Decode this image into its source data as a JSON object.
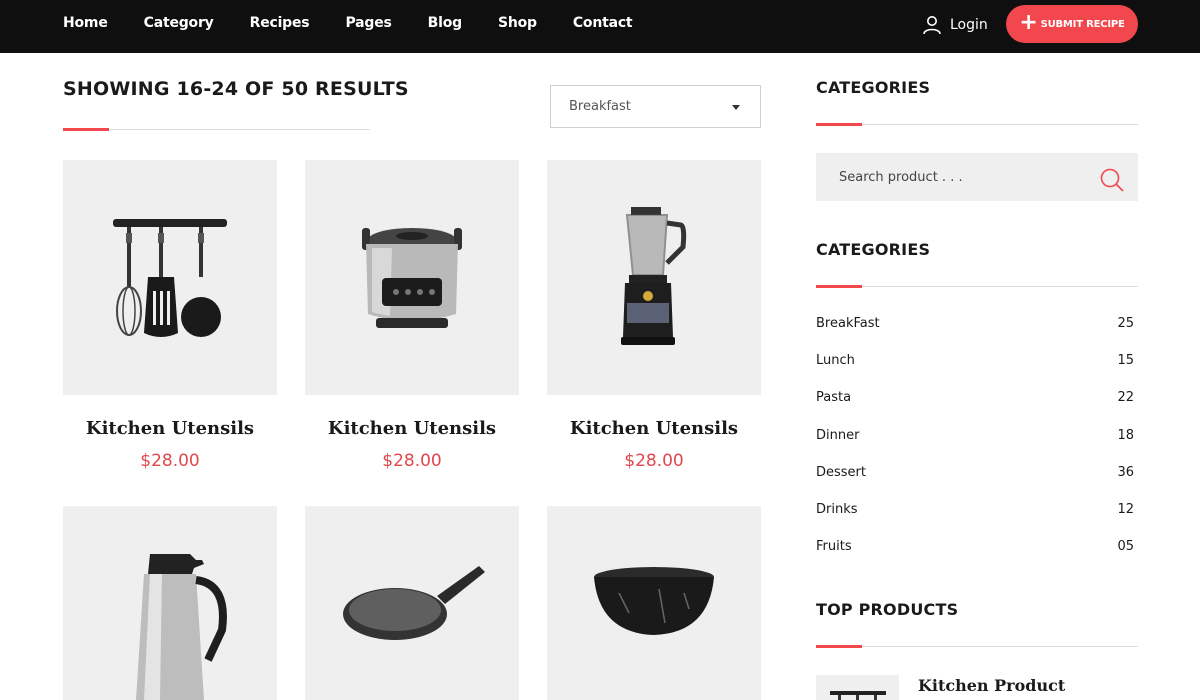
{
  "nav": {
    "items": [
      "Home",
      "Category",
      "Recipes",
      "Pages",
      "Blog",
      "Shop",
      "Contact"
    ],
    "login_label": "Login",
    "submit_label": "SUBMIT RECIPE"
  },
  "results": {
    "title": "SHOWING 16-24 OF 50 RESULTS",
    "sort_selected": "Breakfast"
  },
  "products": [
    {
      "name": "Kitchen Utensils",
      "price": "$28.00",
      "icon": "utensils-rack-icon"
    },
    {
      "name": "Kitchen Utensils",
      "price": "$28.00",
      "icon": "rice-cooker-icon"
    },
    {
      "name": "Kitchen Utensils",
      "price": "$28.00",
      "icon": "blender-icon"
    },
    {
      "name": "",
      "price": "",
      "icon": "thermos-jug-icon"
    },
    {
      "name": "",
      "price": "",
      "icon": "frying-pan-icon"
    },
    {
      "name": "",
      "price": "",
      "icon": "bowl-icon"
    }
  ],
  "sidebar": {
    "categories_title": "CATEGORIES",
    "search_placeholder": "Search product . . .",
    "categories_title_2": "CATEGORIES",
    "categories": [
      {
        "label": "BreakFast",
        "count": "25"
      },
      {
        "label": "Lunch",
        "count": "15"
      },
      {
        "label": "Pasta",
        "count": "22"
      },
      {
        "label": "Dinner",
        "count": "18"
      },
      {
        "label": "Dessert",
        "count": "36"
      },
      {
        "label": "Drinks",
        "count": "12"
      },
      {
        "label": "Fruits",
        "count": "05"
      }
    ],
    "top_products_title": "TOP PRODUCTS",
    "top_product_name": "Kitchen Product"
  },
  "colors": {
    "accent": "#f2474d",
    "topbar": "#0f0f0f",
    "card_bg": "#efefef"
  }
}
